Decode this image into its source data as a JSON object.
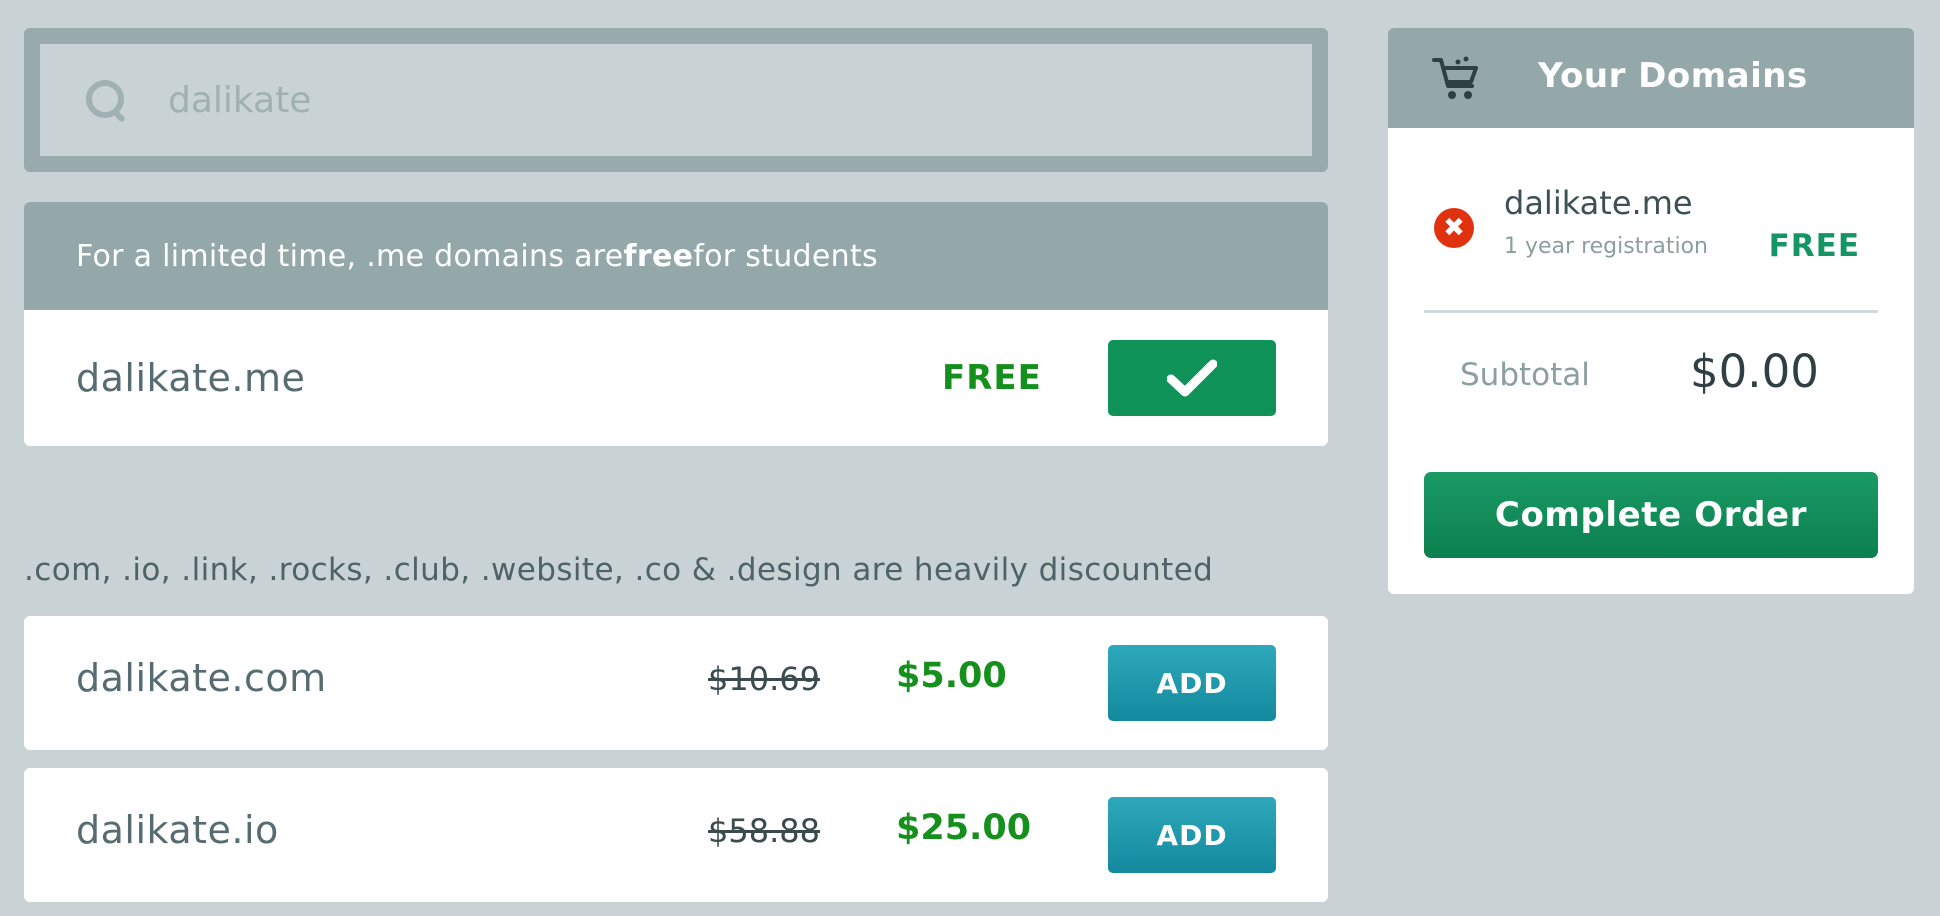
{
  "search": {
    "value": "dalikate",
    "icon": "search-icon"
  },
  "promo": {
    "banner_prefix": "For a limited time, .me domains are ",
    "banner_bold": "free",
    "banner_suffix": " for students",
    "domain": "dalikate.me",
    "price": "FREE",
    "action_icon": "checkmark-icon"
  },
  "discount": {
    "note": ".com, .io, .link, .rocks, .club, .website, .co & .design are heavily discounted",
    "domains": [
      {
        "name": "dalikate.com",
        "old_price": "$10.69",
        "new_price": "$5.00",
        "button_label": "ADD"
      },
      {
        "name": "dalikate.io",
        "old_price": "$58.88",
        "new_price": "$25.00",
        "button_label": "ADD"
      }
    ]
  },
  "cart": {
    "title": "Your Domains",
    "icon": "cart-icon",
    "items": [
      {
        "name": "dalikate.me",
        "term": "1 year registration",
        "price": "FREE",
        "remove_icon": "remove-icon"
      }
    ],
    "subtotal_label": "Subtotal",
    "subtotal_value": "$0.00",
    "complete_label": "Complete Order"
  },
  "colors": {
    "background": "#c9d2d4",
    "banner": "#94a8aa",
    "price_green": "#16901c",
    "check_button": "#109359",
    "add_button": "#1b93a7",
    "complete_button": "#109359",
    "remove_red": "#e0320f"
  }
}
